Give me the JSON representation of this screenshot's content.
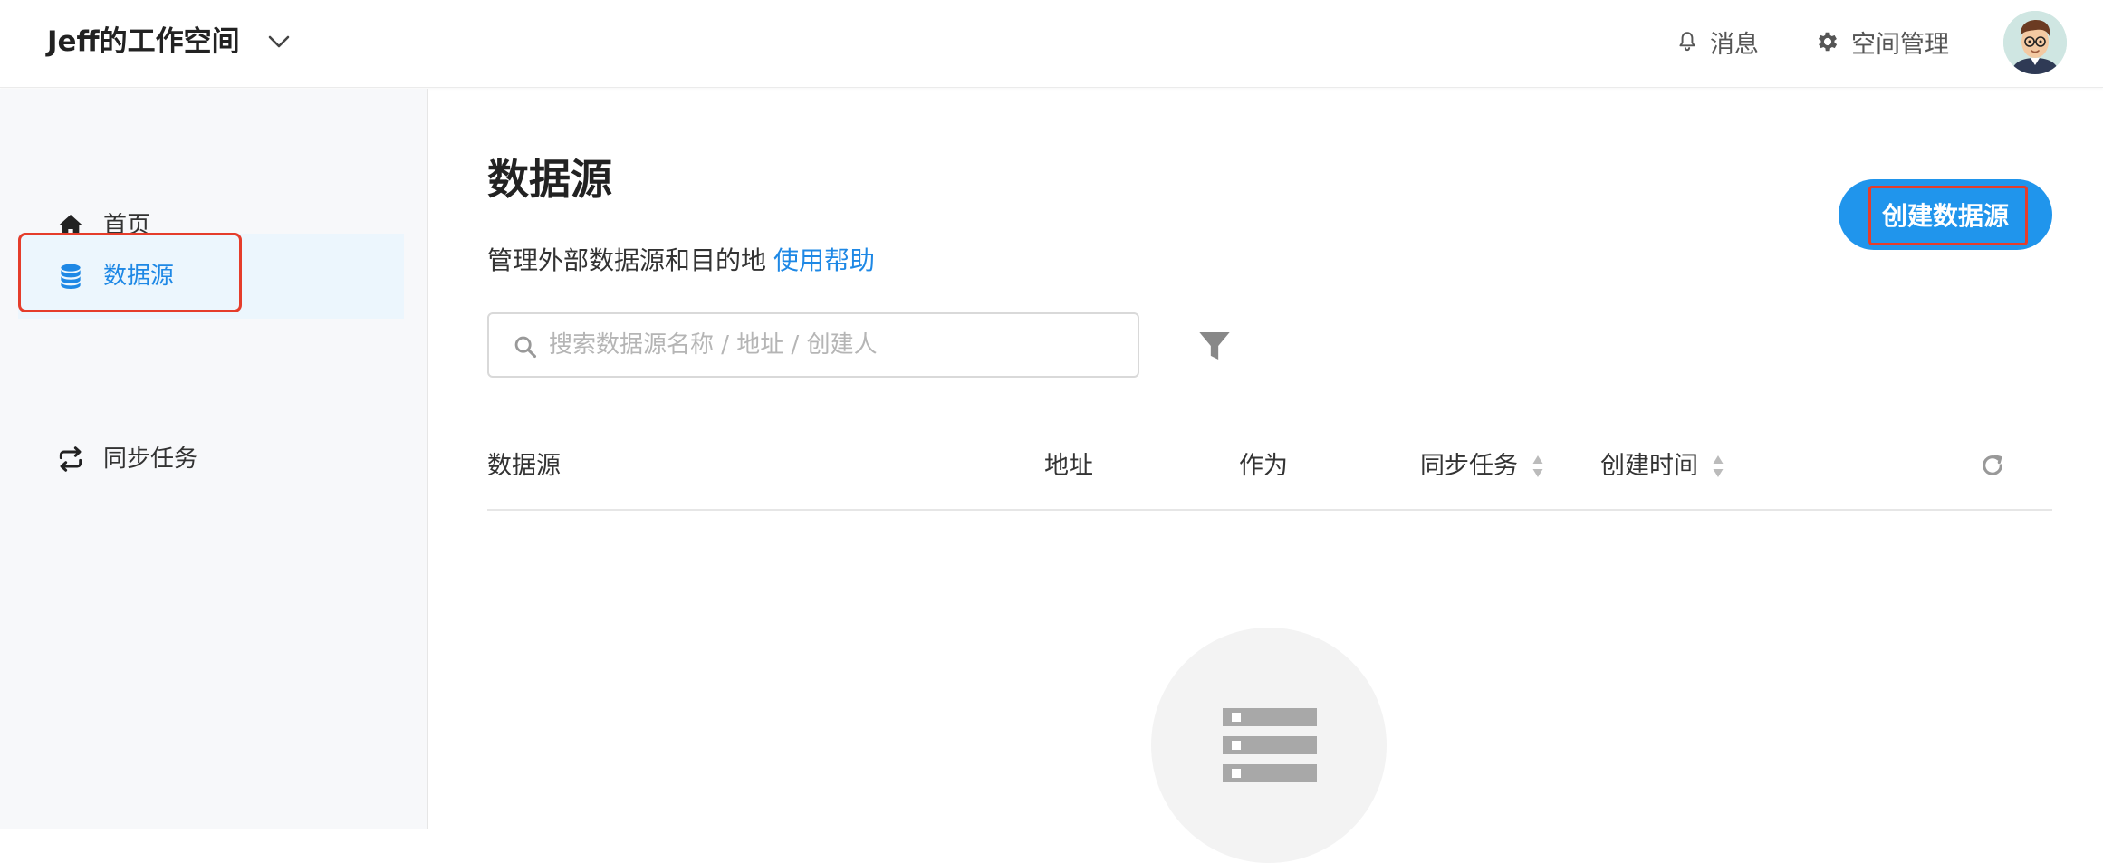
{
  "header": {
    "workspace_title": "Jeff的工作空间",
    "messages_label": "消息",
    "space_admin_label": "空间管理"
  },
  "sidebar": {
    "items": [
      {
        "label": "首页",
        "icon": "home-icon"
      },
      {
        "label": "数据源",
        "icon": "database-icon",
        "active": true
      },
      {
        "label": "同步任务",
        "icon": "sync-icon"
      }
    ]
  },
  "main": {
    "title": "数据源",
    "description": "管理外部数据源和目的地",
    "help_link": "使用帮助",
    "create_button": "创建数据源",
    "search": {
      "placeholder": "搜索数据源名称 / 地址 / 创建人",
      "value": ""
    },
    "table": {
      "columns": [
        "数据源",
        "地址",
        "作为",
        "同步任务",
        "创建时间"
      ],
      "rows": []
    }
  },
  "colors": {
    "accent": "#2095ec",
    "link": "#1e88e5",
    "active_bg": "#ecf6fd",
    "highlight_outline": "#e53d2b"
  }
}
